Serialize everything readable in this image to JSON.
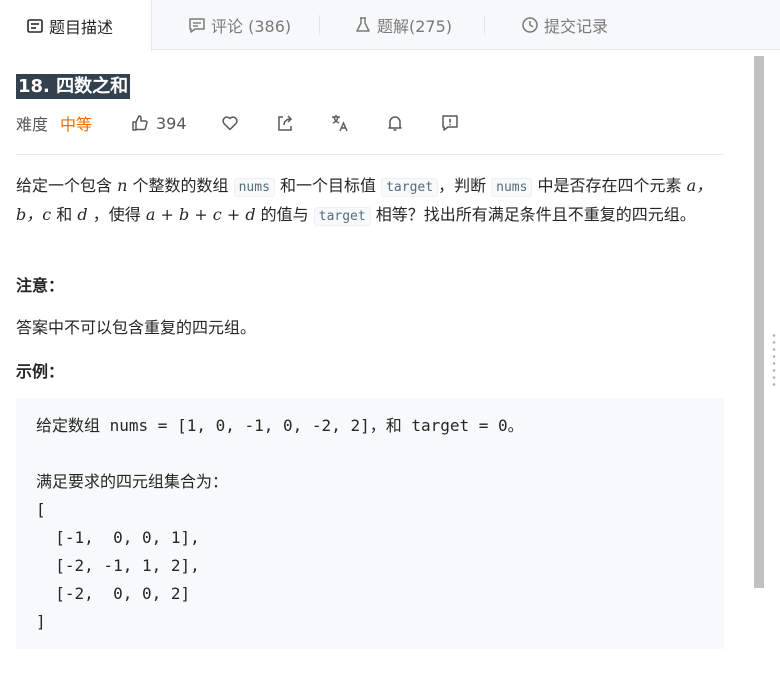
{
  "tabs": [
    {
      "label": "题目描述",
      "icon": "description-icon"
    },
    {
      "label": "评论 (386)",
      "icon": "comment-icon"
    },
    {
      "label": "题解(275)",
      "icon": "flask-icon"
    },
    {
      "label": "提交记录",
      "icon": "clock-icon"
    }
  ],
  "problem": {
    "title": "18. 四数之和",
    "difficulty_label": "难度",
    "difficulty": "中等",
    "likes": "394",
    "difficulty_color": "#ef6c00"
  },
  "description": {
    "seg1": "给定一个包含 ",
    "n": "n",
    "seg2": " 个整数的数组 ",
    "code_nums": "nums",
    "seg3": " 和一个目标值 ",
    "code_target": "target",
    "seg4": "，判断 ",
    "code_nums2": "nums",
    "seg5": " 中是否存在四个元素 ",
    "a": "a，",
    "b": "b，",
    "c": "c",
    "seg6": " 和 ",
    "d": "d",
    "seg7": " ，使得 ",
    "expr": "a + b + c + d",
    "seg8": " 的值与 ",
    "code_target2": "target",
    "seg9": " 相等？找出所有满足条件且不重复的四元组。"
  },
  "note_heading": "注意：",
  "note_text": "答案中不可以包含重复的四元组。",
  "example_heading": "示例：",
  "example_code": "给定数组 nums = [1, 0, -1, 0, -2, 2]，和 target = 0。\n\n满足要求的四元组集合为：\n[\n  [-1,  0, 0, 1],\n  [-2, -1, 1, 2],\n  [-2,  0, 0, 2]\n]"
}
